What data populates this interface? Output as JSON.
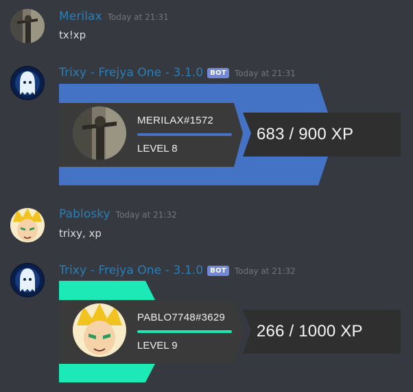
{
  "messages": [
    {
      "author": "Merilax",
      "timestamp": "Today at 21:31",
      "text": "tx!xp"
    },
    {
      "author": "Trixy - Frejya One - 3.1.0",
      "bot_tag": "BOT",
      "timestamp": "Today at 21:31",
      "card": {
        "username": "MERILAX#1572",
        "level": "LEVEL 8",
        "xp": "683 / 900 XP",
        "xp_current": 683,
        "xp_max": 900,
        "accent_color": "#4472c4"
      }
    },
    {
      "author": "Pablosky",
      "timestamp": "Today at 21:32",
      "text": "trixy, xp"
    },
    {
      "author": "Trixy - Frejya One - 3.1.0",
      "bot_tag": "BOT",
      "timestamp": "Today at 21:32",
      "card": {
        "username": "PABLO7748#3629",
        "level": "LEVEL 9",
        "xp": "266 / 1000 XP",
        "xp_current": 266,
        "xp_max": 1000,
        "accent_color": "#1de9b6"
      }
    }
  ],
  "colors": {
    "background": "#36393f",
    "author_name": "#2a7fb8",
    "timestamp": "#72767d",
    "message_text": "#dcddde",
    "bot_tag": "#7289da",
    "card_panel": "#3a3a3a"
  },
  "icons": {
    "merilax_avatar": "user-avatar-icon",
    "bot_avatar": "bot-ghost-avatar-icon",
    "pablosky_avatar": "user-avatar-icon"
  }
}
